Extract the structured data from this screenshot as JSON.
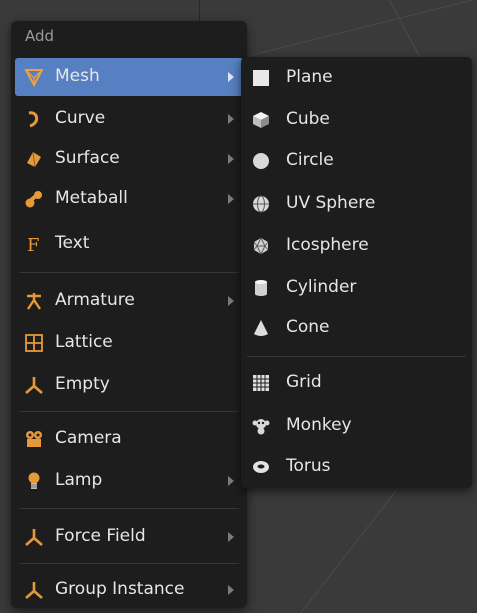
{
  "menu": {
    "title": "Add",
    "items": [
      {
        "label": "Mesh",
        "icon": "mesh-icon",
        "has_submenu": true,
        "highlighted": true
      },
      {
        "label": "Curve",
        "icon": "curve-icon",
        "has_submenu": true
      },
      {
        "label": "Surface",
        "icon": "surface-icon",
        "has_submenu": true
      },
      {
        "label": "Metaball",
        "icon": "metaball-icon",
        "has_submenu": true
      },
      {
        "label": "Text",
        "icon": "text-icon",
        "has_submenu": false
      },
      {
        "label": "Armature",
        "icon": "armature-icon",
        "has_submenu": true
      },
      {
        "label": "Lattice",
        "icon": "lattice-icon",
        "has_submenu": false
      },
      {
        "label": "Empty",
        "icon": "empty-icon",
        "has_submenu": false
      },
      {
        "label": "Camera",
        "icon": "camera-icon",
        "has_submenu": false
      },
      {
        "label": "Lamp",
        "icon": "lamp-icon",
        "has_submenu": true
      },
      {
        "label": "Force Field",
        "icon": "force-field-icon",
        "has_submenu": true
      },
      {
        "label": "Group Instance",
        "icon": "group-instance-icon",
        "has_submenu": true
      }
    ]
  },
  "mesh_submenu": {
    "items": [
      {
        "label": "Plane",
        "icon": "plane-icon"
      },
      {
        "label": "Cube",
        "icon": "cube-icon"
      },
      {
        "label": "Circle",
        "icon": "circle-icon"
      },
      {
        "label": "UV Sphere",
        "icon": "uv-sphere-icon"
      },
      {
        "label": "Icosphere",
        "icon": "icosphere-icon"
      },
      {
        "label": "Cylinder",
        "icon": "cylinder-icon"
      },
      {
        "label": "Cone",
        "icon": "cone-icon"
      },
      {
        "label": "Grid",
        "icon": "grid-icon"
      },
      {
        "label": "Monkey",
        "icon": "monkey-icon"
      },
      {
        "label": "Torus",
        "icon": "torus-icon"
      }
    ]
  },
  "colors": {
    "menu_bg": "#1d1d1d",
    "highlight": "#5680c2",
    "icon_orange": "#e59a3a",
    "text": "#e6e6e6"
  }
}
